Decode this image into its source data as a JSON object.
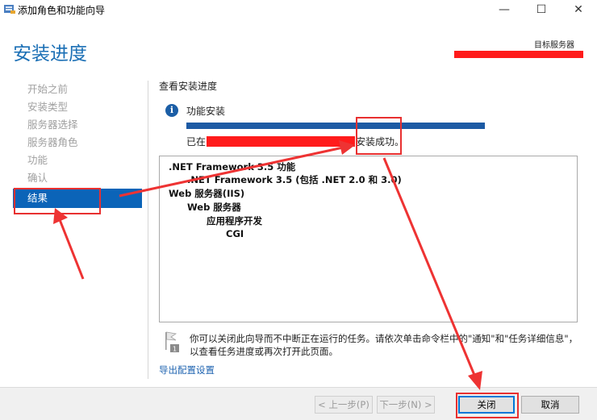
{
  "window": {
    "title": "添加角色和功能向导",
    "minimize_glyph": "—",
    "maximize_glyph": "☐",
    "close_glyph": "✕"
  },
  "header": {
    "page_title": "安装进度",
    "target_label": "目标服务器"
  },
  "sidebar": {
    "items": [
      {
        "label": "开始之前"
      },
      {
        "label": "安装类型"
      },
      {
        "label": "服务器选择"
      },
      {
        "label": "服务器角色"
      },
      {
        "label": "功能"
      },
      {
        "label": "确认"
      },
      {
        "label": "结果"
      }
    ]
  },
  "content": {
    "section_title": "查看安装进度",
    "info_label": "功能安装",
    "progress_value": 1.0,
    "status_prefix": "已在",
    "status_suffix": "安装成功。",
    "results": [
      ".NET Framework 3.5 功能",
      ".NET Framework 3.5 (包括 .NET 2.0 和 3.0)",
      "Web 服务器(IIS)",
      "Web 服务器",
      "应用程序开发",
      "CGI"
    ],
    "note": "你可以关闭此向导而不中断正在运行的任务。请依次单击命令栏中的\"通知\"和\"任务详细信息\"，以查看任务进度或再次打开此页面。",
    "export_link": "导出配置设置"
  },
  "buttons": {
    "prev": "< 上一步(P)",
    "next": "下一步(N) >",
    "close": "关闭",
    "cancel": "取消"
  },
  "icons": {
    "info": "info-icon",
    "note": "flag-icon"
  },
  "colors": {
    "accent": "#1b6fb5",
    "active_step": "#0b64b8",
    "progress": "#1c5aa4",
    "annotation": "#e83030"
  }
}
